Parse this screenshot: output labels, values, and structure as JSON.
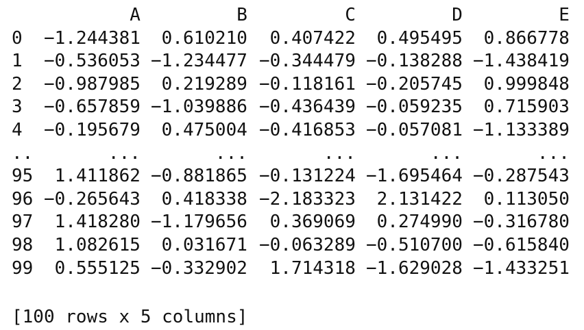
{
  "dataframe": {
    "columns": [
      "A",
      "B",
      "C",
      "D",
      "E"
    ],
    "rows": [
      {
        "index": "0",
        "values": [
          "-1.244381",
          "0.610210",
          "0.407422",
          "0.495495",
          "0.866778"
        ]
      },
      {
        "index": "1",
        "values": [
          "-0.536053",
          "-1.234477",
          "-0.344479",
          "-0.138288",
          "-1.438419"
        ]
      },
      {
        "index": "2",
        "values": [
          "-0.987985",
          "0.219289",
          "-0.118161",
          "-0.205745",
          "0.999848"
        ]
      },
      {
        "index": "3",
        "values": [
          "-0.657859",
          "-1.039886",
          "-0.436439",
          "-0.059235",
          "0.715903"
        ]
      },
      {
        "index": "4",
        "values": [
          "-0.195679",
          "0.475004",
          "-0.416853",
          "-0.057081",
          "-1.133389"
        ]
      },
      {
        "index": "..",
        "values": [
          "...",
          "...",
          "...",
          "...",
          "..."
        ]
      },
      {
        "index": "95",
        "values": [
          "1.411862",
          "-0.881865",
          "-0.131224",
          "-1.695464",
          "-0.287543"
        ]
      },
      {
        "index": "96",
        "values": [
          "-0.265643",
          "0.418338",
          "-2.183323",
          "2.131422",
          "0.113050"
        ]
      },
      {
        "index": "97",
        "values": [
          "1.418280",
          "-1.179656",
          "0.369069",
          "0.274990",
          "-0.316780"
        ]
      },
      {
        "index": "98",
        "values": [
          "1.082615",
          "0.031671",
          "-0.063289",
          "-0.510700",
          "-0.615840"
        ]
      },
      {
        "index": "99",
        "values": [
          "0.555125",
          "-0.332902",
          "1.714318",
          "-1.629028",
          "-1.433251"
        ]
      }
    ],
    "summary": "[100 rows x 5 columns]"
  }
}
